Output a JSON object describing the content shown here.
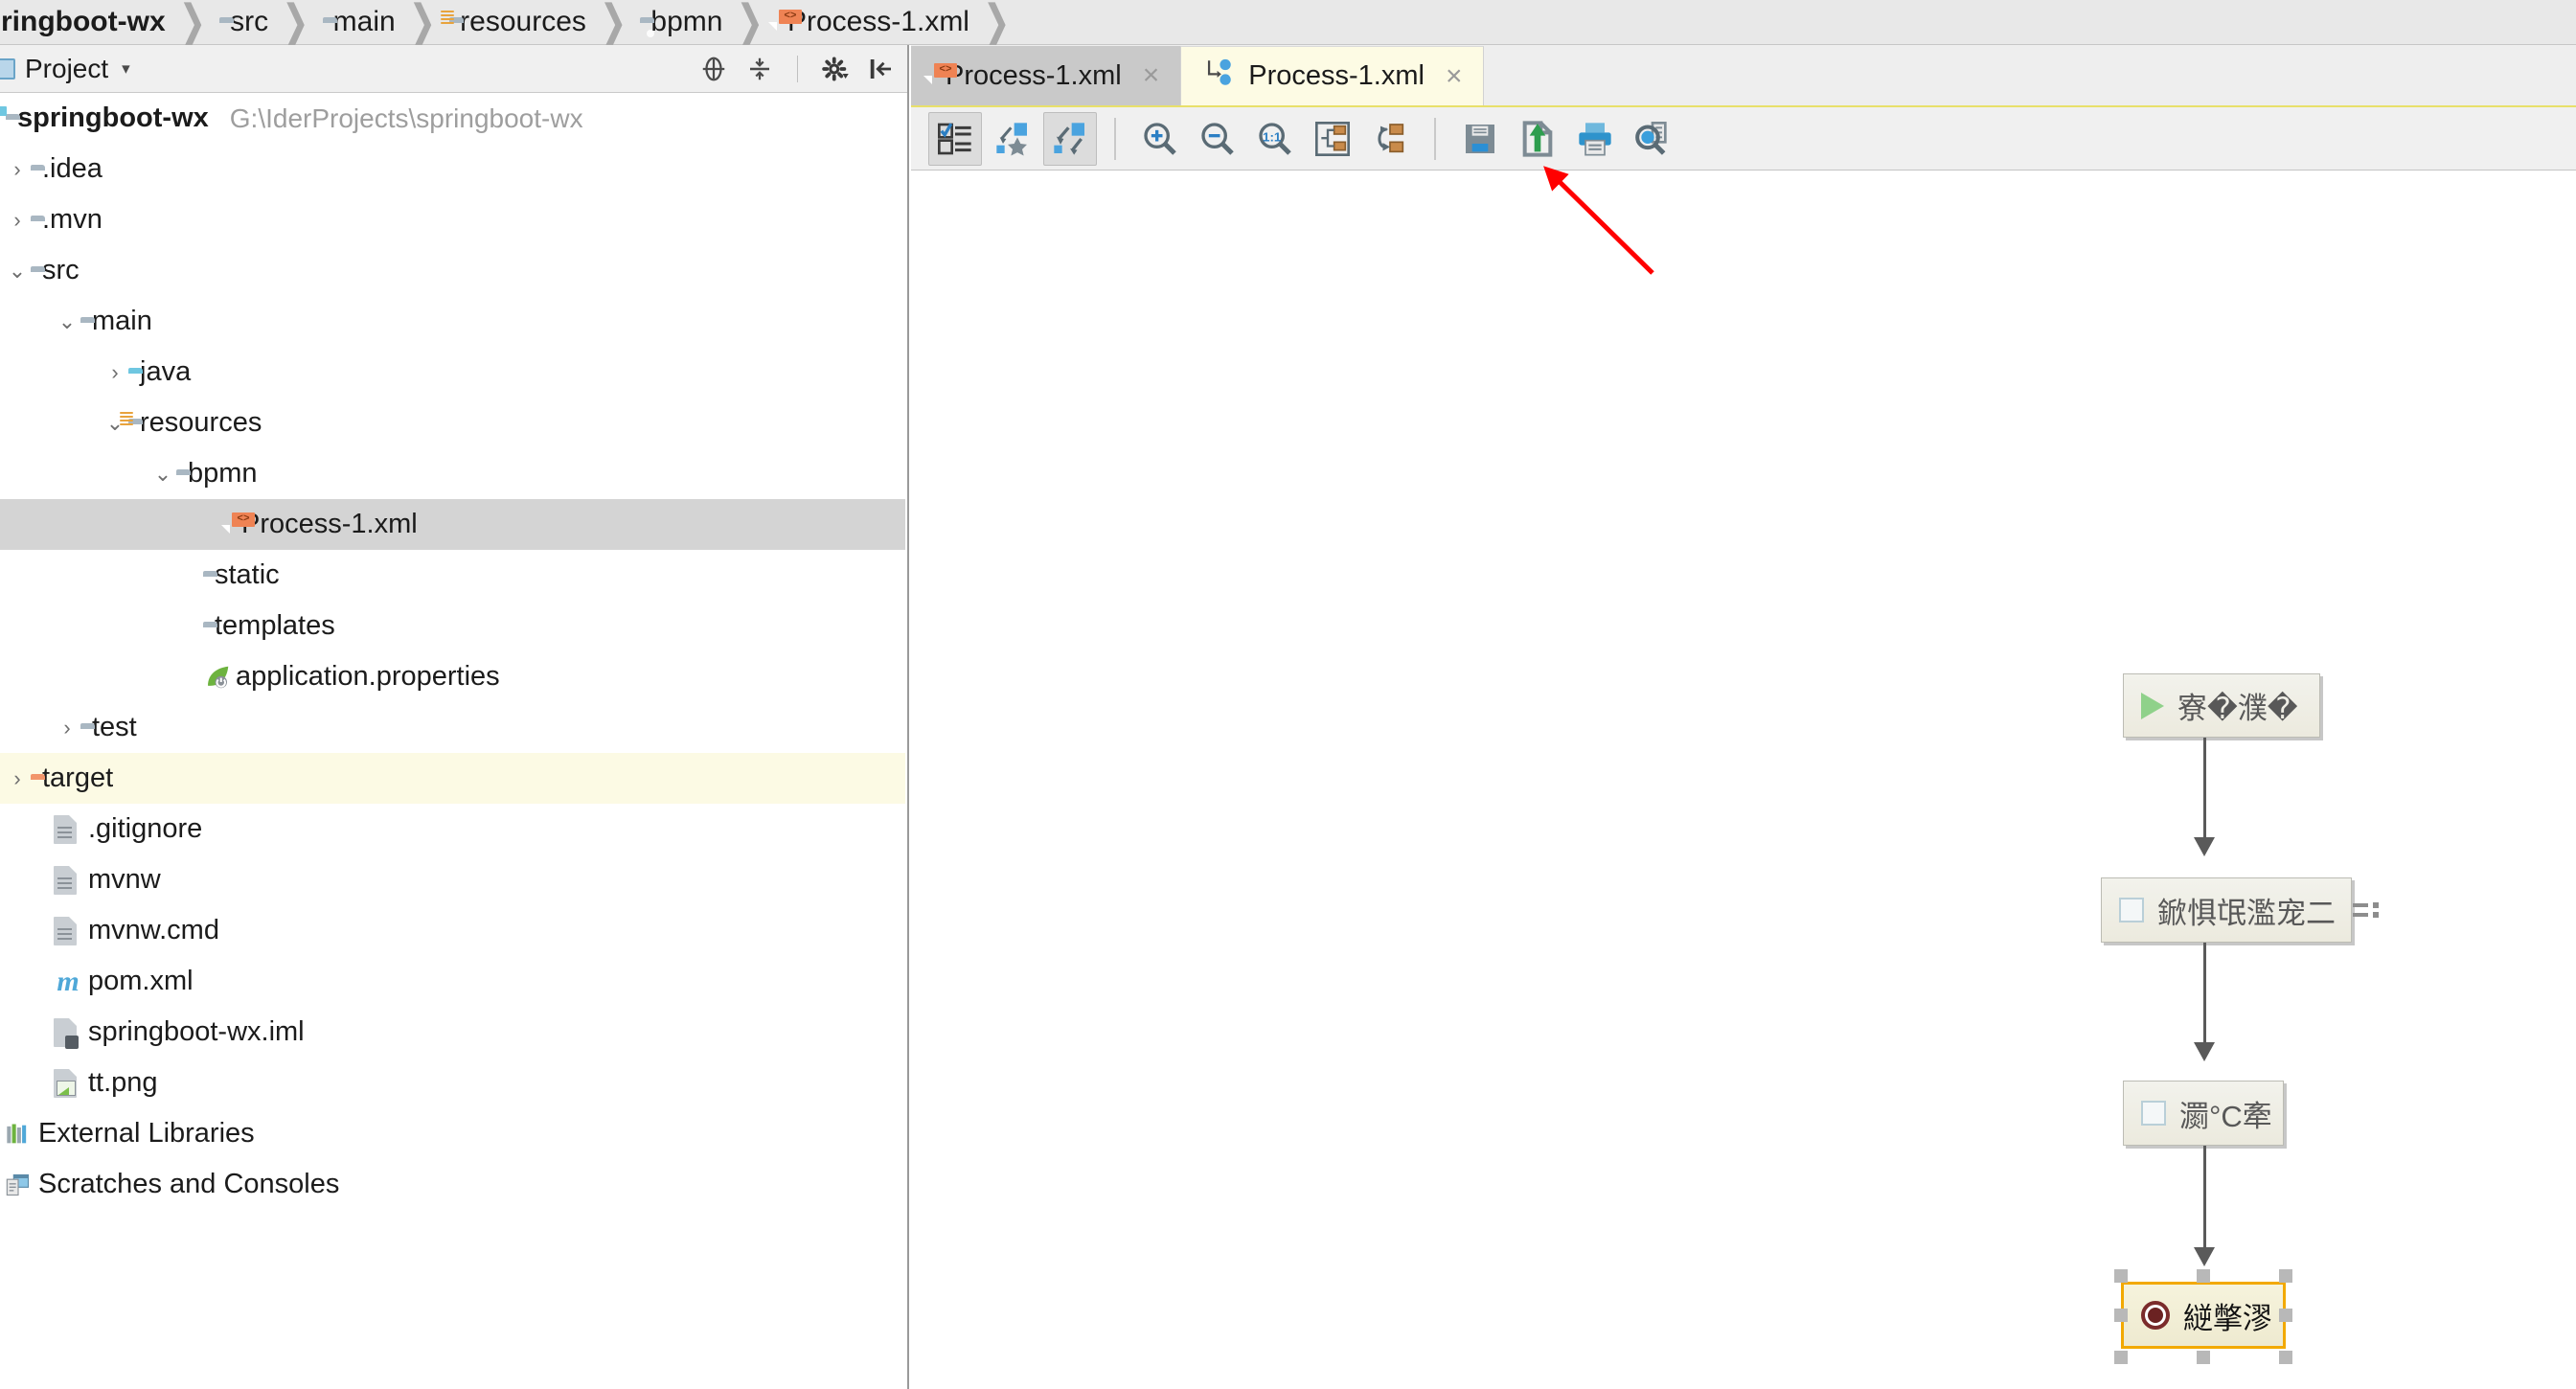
{
  "breadcrumb": {
    "items": [
      {
        "label": "ringboot-wx",
        "icon": "none",
        "bold": true
      },
      {
        "label": "src",
        "icon": "folder-icon"
      },
      {
        "label": "main",
        "icon": "folder-icon"
      },
      {
        "label": "resources",
        "icon": "resources-folder-icon"
      },
      {
        "label": "bpmn",
        "icon": "folder-dot-icon"
      },
      {
        "label": "Process-1.xml",
        "icon": "xml-file-icon"
      }
    ],
    "separator": "❯"
  },
  "project_panel": {
    "header": {
      "title": "Project",
      "caret": "▾",
      "actions": [
        {
          "name": "locate-icon",
          "glyph": "⊕"
        },
        {
          "name": "collapse-all-icon",
          "glyph": "⨍"
        },
        {
          "name": "settings-gear-icon",
          "glyph": "⚙"
        },
        {
          "name": "hide-panel-icon",
          "glyph": "⇥"
        }
      ]
    },
    "tree": [
      {
        "label": "springboot-wx",
        "path": "G:\\IderProjects\\springboot-wx",
        "icon": "module-folder-icon",
        "indent": 0,
        "chevron": "",
        "bold": true,
        "state": "normal"
      },
      {
        "label": ".idea",
        "icon": "folder-icon",
        "indent": 1,
        "chevron": "›",
        "state": "normal"
      },
      {
        "label": ".mvn",
        "icon": "folder-icon",
        "indent": 1,
        "chevron": "›",
        "state": "normal"
      },
      {
        "label": "src",
        "icon": "folder-icon",
        "indent": 1,
        "chevron": "⌄",
        "state": "normal"
      },
      {
        "label": "main",
        "icon": "folder-icon",
        "indent": 2,
        "chevron": "⌄",
        "state": "normal"
      },
      {
        "label": "java",
        "icon": "source-folder-icon",
        "indent": 3,
        "chevron": "›",
        "state": "normal"
      },
      {
        "label": "resources",
        "icon": "resources-folder-icon",
        "indent": 3,
        "chevron": "⌄",
        "state": "normal"
      },
      {
        "label": "bpmn",
        "icon": "folder-dot-icon",
        "indent": 4,
        "chevron": "⌄",
        "state": "normal"
      },
      {
        "label": "Process-1.xml",
        "icon": "xml-file-icon",
        "indent": 5,
        "chevron": "",
        "state": "selected"
      },
      {
        "label": "static",
        "icon": "folder-dot-icon",
        "indent": 4,
        "chevron": "",
        "state": "normal"
      },
      {
        "label": "templates",
        "icon": "folder-dot-icon",
        "indent": 4,
        "chevron": "",
        "state": "normal"
      },
      {
        "label": "application.properties",
        "icon": "spring-leaf-icon",
        "indent": 4,
        "chevron": "",
        "state": "normal"
      },
      {
        "label": "test",
        "icon": "folder-icon",
        "indent": 2,
        "chevron": "›",
        "state": "normal"
      },
      {
        "label": "target",
        "icon": "target-folder-icon",
        "indent": 1,
        "chevron": "›",
        "state": "highlight"
      },
      {
        "label": ".gitignore",
        "icon": "text-file-icon",
        "indent": 2,
        "chevron": "",
        "state": "normal"
      },
      {
        "label": "mvnw",
        "icon": "text-file-icon",
        "indent": 2,
        "chevron": "",
        "state": "normal"
      },
      {
        "label": "mvnw.cmd",
        "icon": "text-file-icon",
        "indent": 2,
        "chevron": "",
        "state": "normal"
      },
      {
        "label": "pom.xml",
        "icon": "maven-icon",
        "indent": 2,
        "chevron": "",
        "state": "normal"
      },
      {
        "label": "springboot-wx.iml",
        "icon": "iml-file-icon",
        "indent": 2,
        "chevron": "",
        "state": "normal"
      },
      {
        "label": "tt.png",
        "icon": "image-file-icon",
        "indent": 2,
        "chevron": "",
        "state": "normal"
      },
      {
        "label": "External Libraries",
        "icon": "libraries-icon",
        "indent": 0,
        "chevron": "",
        "state": "normal"
      },
      {
        "label": "Scratches and Consoles",
        "icon": "scratches-icon",
        "indent": 0,
        "chevron": "",
        "state": "normal"
      }
    ]
  },
  "editor": {
    "tabs": [
      {
        "label": "Process-1.xml",
        "icon": "xml-file-icon",
        "active": false,
        "close": "×"
      },
      {
        "label": "Process-1.xml",
        "icon": "bpmn-designer-icon",
        "active": true,
        "close": "×"
      }
    ],
    "toolbar": [
      {
        "name": "validate-icon",
        "pressed": true
      },
      {
        "name": "favorite-layout-icon",
        "pressed": false
      },
      {
        "name": "auto-layout-icon",
        "pressed": true
      },
      {
        "name": "separator"
      },
      {
        "name": "zoom-in-icon",
        "pressed": false
      },
      {
        "name": "zoom-out-icon",
        "pressed": false
      },
      {
        "name": "zoom-actual-icon",
        "label": "1:1",
        "pressed": false
      },
      {
        "name": "fit-to-window-icon",
        "pressed": false
      },
      {
        "name": "refresh-layout-icon",
        "pressed": false
      },
      {
        "name": "separator"
      },
      {
        "name": "save-icon",
        "pressed": false
      },
      {
        "name": "export-icon",
        "pressed": false
      },
      {
        "name": "print-icon",
        "pressed": false
      },
      {
        "name": "preview-icon",
        "pressed": false
      }
    ]
  },
  "diagram": {
    "nodes": [
      {
        "id": "start-event",
        "type": "start",
        "label": "寮�濮�",
        "selected": false,
        "has_menu": false
      },
      {
        "id": "user-task-1",
        "type": "task",
        "label": "鍁惧氓濫宠二",
        "selected": false,
        "has_menu": true
      },
      {
        "id": "user-task-2",
        "type": "task",
        "label": "瀱°C牽",
        "selected": false,
        "has_menu": false
      },
      {
        "id": "end-event",
        "type": "end",
        "label": "縌撆漻",
        "selected": true,
        "has_menu": false
      }
    ],
    "connectors": 3,
    "annotation": {
      "name": "red-arrow-annotation",
      "color": "#ff0000",
      "points_to": "export-icon"
    }
  },
  "colors": {
    "tab_active_bg": "#fdfbe4",
    "tab_inactive_bg": "#c9c9c9",
    "selection_bg": "#d4d4d4",
    "highlight_bg": "#fcfae4",
    "node_border_selected": "#f2a900",
    "annotation_red": "#ff0000",
    "xml_badge": "#ef8354"
  }
}
